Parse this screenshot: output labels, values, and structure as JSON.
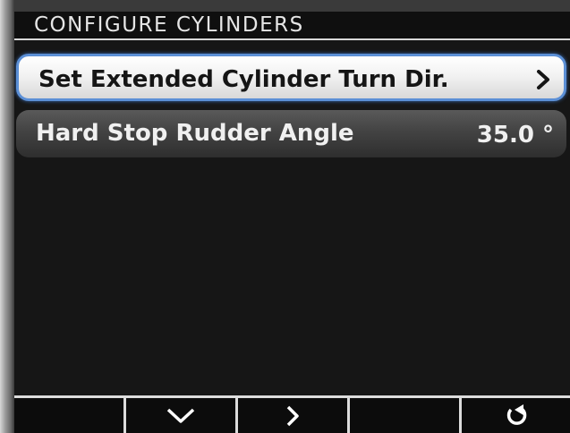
{
  "header": {
    "title": "CONFIGURE CYLINDERS"
  },
  "menu": {
    "items": [
      {
        "label": "Set Extended Cylinder Turn Dir.",
        "selected": true,
        "trailing_icon": "chevron-right-icon"
      },
      {
        "label": "Hard Stop Rudder Angle",
        "value": "35.0 °",
        "selected": false
      }
    ]
  },
  "softkeys": [
    {
      "icon": "",
      "label": ""
    },
    {
      "icon": "chevron-down-icon",
      "label": ""
    },
    {
      "icon": "chevron-right-icon",
      "label": ""
    },
    {
      "icon": "",
      "label": ""
    },
    {
      "icon": "back-arrow-icon",
      "label": ""
    }
  ],
  "colors": {
    "screen_background": "#161616",
    "selected_item_border": "#5b8fd6",
    "selected_item_fill": "#f2f2f2",
    "item_fill": "#454545",
    "text_light": "#f0f0f0",
    "text_dark": "#151515"
  }
}
